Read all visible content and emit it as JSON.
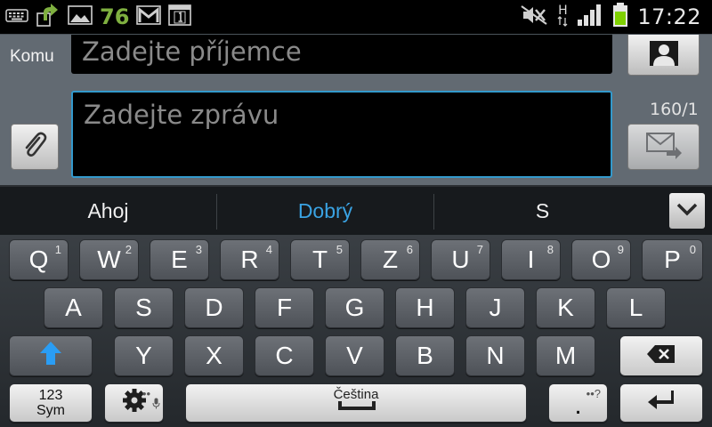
{
  "status_bar": {
    "notification_count": "76",
    "network_type": "H",
    "time": "17:22",
    "colors": {
      "battery": "#7fd000",
      "badge_text": "#7fb040"
    }
  },
  "compose": {
    "to_label": "Komu",
    "recipient_placeholder": "Zadejte příjemce",
    "message_placeholder": "Zadejte zprávu",
    "char_counter": "160/1",
    "colors": {
      "background": "#626a72",
      "focus_border": "#3399cc"
    }
  },
  "suggestions": {
    "items": [
      "Ahoj",
      "Dobrý",
      "S"
    ],
    "highlight_color": "#3aa3e3"
  },
  "keyboard": {
    "row1": [
      {
        "label": "Q",
        "hint": "1"
      },
      {
        "label": "W",
        "hint": "2"
      },
      {
        "label": "E",
        "hint": "3"
      },
      {
        "label": "R",
        "hint": "4"
      },
      {
        "label": "T",
        "hint": "5"
      },
      {
        "label": "Z",
        "hint": "6"
      },
      {
        "label": "U",
        "hint": "7"
      },
      {
        "label": "I",
        "hint": "8"
      },
      {
        "label": "O",
        "hint": "9"
      },
      {
        "label": "P",
        "hint": "0"
      }
    ],
    "row2": [
      "A",
      "S",
      "D",
      "F",
      "G",
      "H",
      "J",
      "K",
      "L"
    ],
    "row3": [
      "Y",
      "X",
      "C",
      "V",
      "B",
      "N",
      "M"
    ],
    "sym_key": {
      "line1": "123",
      "line2": "Sym"
    },
    "space_label": "Čeština",
    "period_label": ".",
    "period_hint": "••?",
    "settings_hint": "••",
    "colors": {
      "shift_arrow": "#2a9df4"
    }
  }
}
